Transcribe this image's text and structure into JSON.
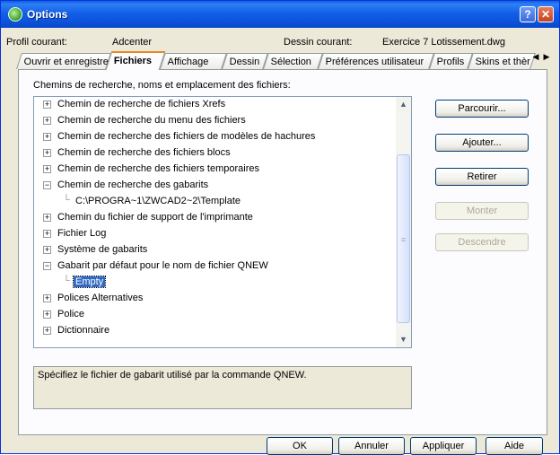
{
  "window": {
    "title": "Options"
  },
  "profile": {
    "label": "Profil courant:",
    "value": "Adcenter"
  },
  "drawing": {
    "label": "Dessin courant:",
    "value": "Exercice 7 Lotissement.dwg"
  },
  "tabs": [
    "Ouvrir et enregistrer",
    "Fichiers",
    "Affichage",
    "Dessin",
    "Sélection",
    "Préférences utilisateur",
    "Profils",
    "Skins et thèr"
  ],
  "active_tab": "Fichiers",
  "section_label": "Chemins de recherche, noms et emplacement des fichiers:",
  "tree": [
    {
      "text": "Chemin de recherche de fichiers Xrefs",
      "expander": "+"
    },
    {
      "text": "Chemin de recherche du menu des fichiers",
      "expander": "+"
    },
    {
      "text": "Chemin de recherche des fichiers de modèles de hachures",
      "expander": "+"
    },
    {
      "text": "Chemin de recherche des fichiers blocs",
      "expander": "+"
    },
    {
      "text": "Chemin de recherche des fichiers temporaires",
      "expander": "+"
    },
    {
      "text": "Chemin de recherche des gabarits",
      "expander": "−"
    },
    {
      "text": "C:\\PROGRA~1\\ZWCAD2~2\\Template",
      "expander": ""
    },
    {
      "text": "Chemin du fichier de support de l'imprimante",
      "expander": "+"
    },
    {
      "text": "Fichier Log",
      "expander": "+"
    },
    {
      "text": "Système de gabarits",
      "expander": "+"
    },
    {
      "text": "Gabarit par défaut pour le nom de fichier QNEW",
      "expander": "−"
    },
    {
      "text": "Empty",
      "expander": ""
    },
    {
      "text": "Polices Alternatives",
      "expander": "+"
    },
    {
      "text": "Police",
      "expander": "+"
    },
    {
      "text": "Dictionnaire",
      "expander": "+"
    }
  ],
  "buttons": {
    "browse": "Parcourir...",
    "add": "Ajouter...",
    "remove": "Retirer",
    "up": "Monter",
    "down": "Descendre"
  },
  "description": "Spécifiez le fichier de gabarit utilisé par la  commande QNEW.",
  "footer": {
    "ok": "OK",
    "cancel": "Annuler",
    "apply": "Appliquer",
    "help": "Aide"
  },
  "icons": {
    "app": "zwcad-logo-icon",
    "help": "help-icon",
    "close": "close-icon"
  },
  "colors": {
    "titlebar": "#0a5fe4",
    "selection": "#316ac5",
    "window_bg": "#ece9d8"
  }
}
